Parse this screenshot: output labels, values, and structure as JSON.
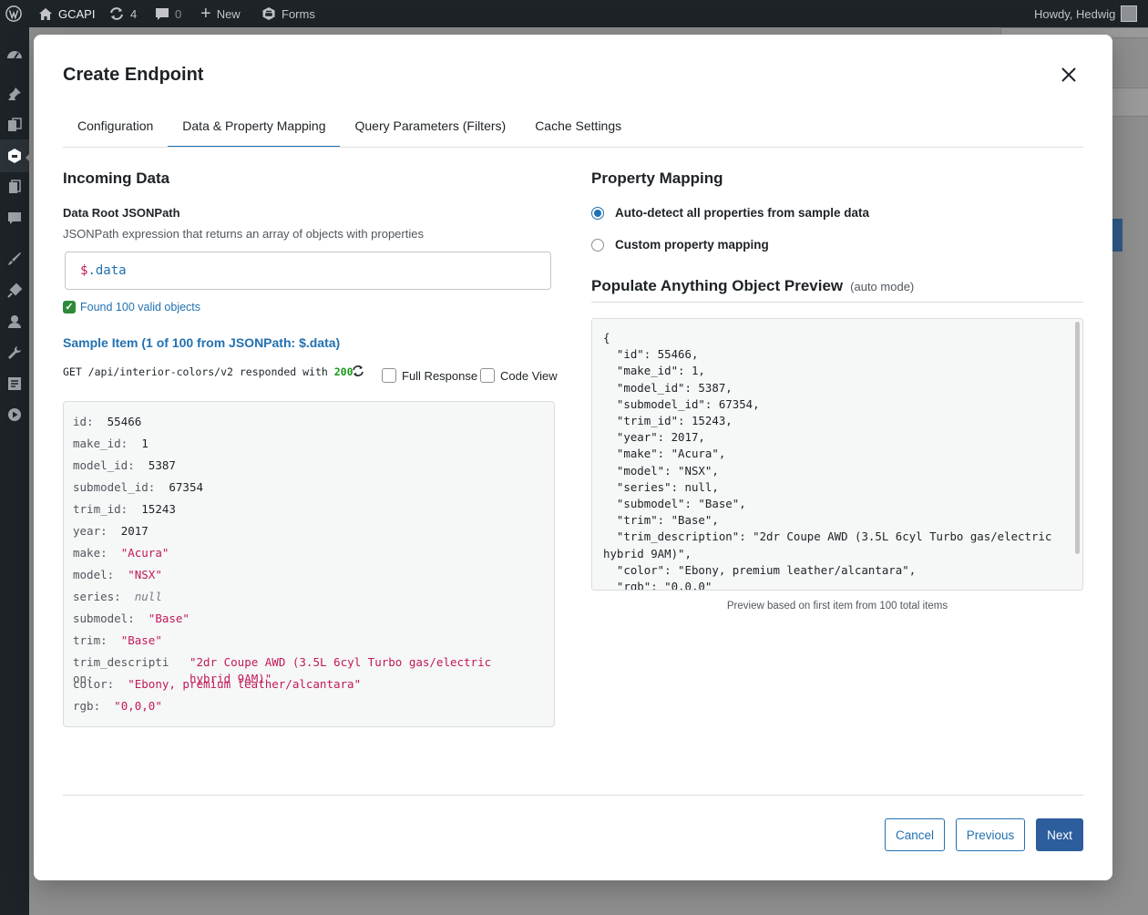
{
  "adminbar": {
    "site_name": "GCAPI",
    "updates_count": "4",
    "comments_count": "0",
    "new_label": "New",
    "forms_label": "Forms",
    "greeting": "Howdy, Hedwig"
  },
  "sidebar": {
    "icons": [
      "dashboard-icon",
      "pin-icon",
      "media-icon",
      "gcapi-icon",
      "pages-icon",
      "comments-icon",
      "appearance-icon",
      "plugins-icon",
      "users-icon",
      "tools-icon",
      "settings-icon",
      "play-icon"
    ]
  },
  "modal": {
    "title": "Create Endpoint",
    "tabs": [
      {
        "label": "Configuration",
        "active": false
      },
      {
        "label": "Data & Property Mapping",
        "active": true
      },
      {
        "label": "Query Parameters (Filters)",
        "active": false
      },
      {
        "label": "Cache Settings",
        "active": false
      }
    ],
    "incoming": {
      "heading": "Incoming Data",
      "root_label": "Data Root JSONPath",
      "root_help": "JSONPath expression that returns an array of objects with properties",
      "root_symbol": "$",
      "root_path": ".data",
      "found_message": "Found 100 valid objects",
      "sample_title": "Sample Item (1 of 100 from JSONPath: $.data)",
      "request_text": "GET /api/interior-colors/v2 responded with",
      "status_code": "200",
      "full_response_label": "Full Response",
      "code_view_label": "Code View",
      "sample_fields": [
        {
          "key": "id:",
          "value": "55466",
          "type": "num"
        },
        {
          "key": "make_id:",
          "value": "1",
          "type": "num"
        },
        {
          "key": "model_id:",
          "value": "5387",
          "type": "num"
        },
        {
          "key": "submodel_id:",
          "value": "67354",
          "type": "num"
        },
        {
          "key": "trim_id:",
          "value": "15243",
          "type": "num"
        },
        {
          "key": "year:",
          "value": "2017",
          "type": "num"
        },
        {
          "key": "make:",
          "value": "\"Acura\"",
          "type": "str"
        },
        {
          "key": "model:",
          "value": "\"NSX\"",
          "type": "str"
        },
        {
          "key": "series:",
          "value": "null",
          "type": "nul"
        },
        {
          "key": "submodel:",
          "value": "\"Base\"",
          "type": "str"
        },
        {
          "key": "trim:",
          "value": "\"Base\"",
          "type": "str"
        },
        {
          "key": "trim_descripti",
          "value": "\"2dr Coupe AWD (3.5L 6cyl Turbo gas/electric",
          "type": "str"
        },
        {
          "key": "color:",
          "value": "\"Ebony, premium leather/alcantara\"",
          "type": "str"
        },
        {
          "key": "rgb:",
          "value": "\"0,0,0\"",
          "type": "str"
        }
      ],
      "trim_overflow_key": "on:",
      "trim_overflow_value": "hybrid 9AM)\""
    },
    "mapping": {
      "heading": "Property Mapping",
      "options": [
        {
          "label": "Auto-detect all properties from sample data",
          "selected": true
        },
        {
          "label": "Custom property mapping",
          "selected": false
        }
      ],
      "preview_title": "Populate Anything Object Preview",
      "preview_mode": "(auto mode)",
      "preview_json": "{\n  \"id\": 55466,\n  \"make_id\": 1,\n  \"model_id\": 5387,\n  \"submodel_id\": 67354,\n  \"trim_id\": 15243,\n  \"year\": 2017,\n  \"make\": \"Acura\",\n  \"model\": \"NSX\",\n  \"series\": null,\n  \"submodel\": \"Base\",\n  \"trim\": \"Base\",\n  \"trim_description\": \"2dr Coupe AWD (3.5L 6cyl Turbo gas/electric\nhybrid 9AM)\",\n  \"color\": \"Ebony, premium leather/alcantara\",\n  \"rgb\": \"0,0,0\"",
      "preview_note": "Preview based on first item from 100 total items"
    },
    "footer": {
      "cancel": "Cancel",
      "previous": "Previous",
      "next": "Next"
    }
  },
  "colors": {
    "accent": "#2271b1",
    "primary_button": "#2c5d9c",
    "string_value": "#c2185b",
    "status_ok": "#1a9a1a"
  }
}
